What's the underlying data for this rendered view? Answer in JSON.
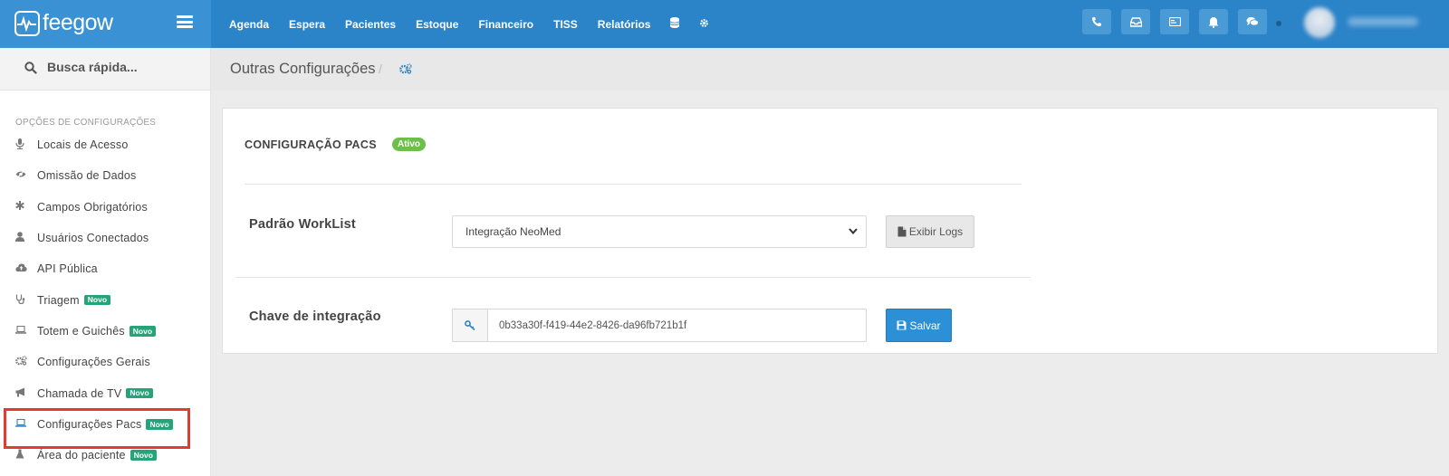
{
  "app": {
    "logo_text": "feegow"
  },
  "topnav": {
    "items": [
      {
        "label": "Agenda"
      },
      {
        "label": "Espera"
      },
      {
        "label": "Pacientes"
      },
      {
        "label": "Estoque"
      },
      {
        "label": "Financeiro"
      },
      {
        "label": "TISS"
      },
      {
        "label": "Relatórios"
      }
    ],
    "extra_icons": [
      "database-icon",
      "gear-icon"
    ],
    "right_icons": [
      "phone-icon",
      "inbox-icon",
      "card-icon",
      "bell-icon",
      "chat-icon"
    ]
  },
  "sidebar": {
    "search_placeholder": "Busca rápida...",
    "header": "OPÇÕES DE CONFIGURAÇÕES",
    "items": [
      {
        "label": "Locais de Acesso",
        "icon": "microphone-icon"
      },
      {
        "label": "Omissão de Dados",
        "icon": "eye-slash-icon"
      },
      {
        "label": "Campos Obrigatórios",
        "icon": "asterisk-icon"
      },
      {
        "label": "Usuários Conectados",
        "icon": "user-icon"
      },
      {
        "label": "API Pública",
        "icon": "cloud-upload-icon"
      },
      {
        "label": "Triagem",
        "icon": "stethoscope-icon",
        "badge": "Novo"
      },
      {
        "label": "Totem e Guichês",
        "icon": "laptop-icon",
        "badge": "Novo"
      },
      {
        "label": "Configurações Gerais",
        "icon": "gears-icon"
      },
      {
        "label": "Chamada de TV",
        "icon": "bullhorn-icon",
        "badge": "Novo"
      },
      {
        "label": "Configurações Pacs",
        "icon": "laptop-icon",
        "badge": "Novo",
        "highlighted": true
      },
      {
        "label": "Área do paciente",
        "icon": "flask-icon",
        "badge": "Novo"
      }
    ]
  },
  "breadcrumb": {
    "title": "Outras Configurações",
    "separator": "/"
  },
  "panel": {
    "title": "CONFIGURAÇÃO PACS",
    "status_badge": "Ativo",
    "worklist_label": "Padrão WorkList",
    "worklist_value": "Integração NeoMed",
    "logs_button": "Exibir Logs",
    "key_label": "Chave de integração",
    "key_value": "0b33a30f-f419-44e2-8426-da96fb721b1f",
    "save_button": "Salvar"
  },
  "colors": {
    "topbar": "#2b83c8",
    "brand_bg": "#3a92d4",
    "badge_novo": "#25a47a",
    "badge_ativo": "#6cc04a",
    "highlight_box": "#e33b2e",
    "save_button": "#2d8fd5"
  }
}
